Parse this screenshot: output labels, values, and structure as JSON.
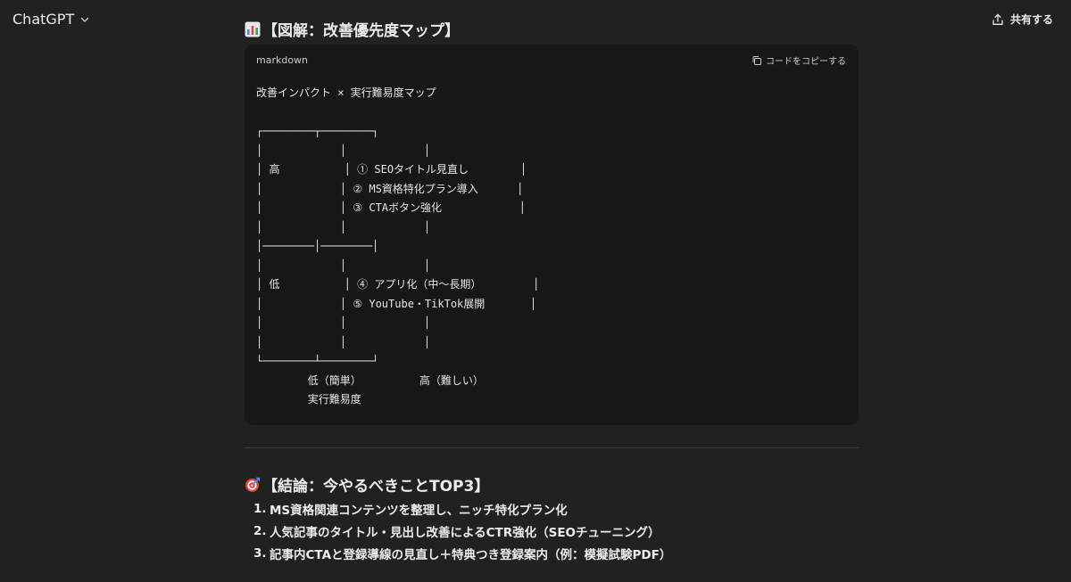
{
  "header": {
    "model_name": "ChatGPT",
    "share_label": "共有する"
  },
  "section1": {
    "emoji": "bar-chart-icon",
    "title": "【図解：改善優先度マップ】"
  },
  "code_block": {
    "language": "markdown",
    "copy_label": "コードをコピーする",
    "lines": [
      "改善インパクト × 実行難易度マップ",
      "",
      "┌────────┬────────┐",
      "│            │            │",
      "│ 高          │ ① SEOタイトル見直し        │",
      "│            │ ② MS資格特化プラン導入      │",
      "│            │ ③ CTAボタン強化            │",
      "│            │            │",
      "│────────│────────│",
      "│            │            │",
      "│ 低          │ ④ アプリ化（中〜長期）        │",
      "│            │ ⑤ YouTube・TikTok展開       │",
      "│            │            │",
      "│            │            │",
      "└────────┴────────┘",
      "        低（簡単）         高（難しい）",
      "        実行難易度"
    ]
  },
  "section2": {
    "emoji": "target-icon",
    "title": "【結論：今やるべきことTOP3】",
    "items": [
      {
        "num": "1.",
        "text": "MS資格関連コンテンツを整理し、ニッチ特化プラン化"
      },
      {
        "num": "2.",
        "text": "人気記事のタイトル・見出し改善によるCTR強化（SEOチューニング）"
      },
      {
        "num": "3.",
        "text": "記事内CTAと登録導線の見直し＋特典つき登録案内（例：模擬試験PDF）"
      }
    ]
  }
}
